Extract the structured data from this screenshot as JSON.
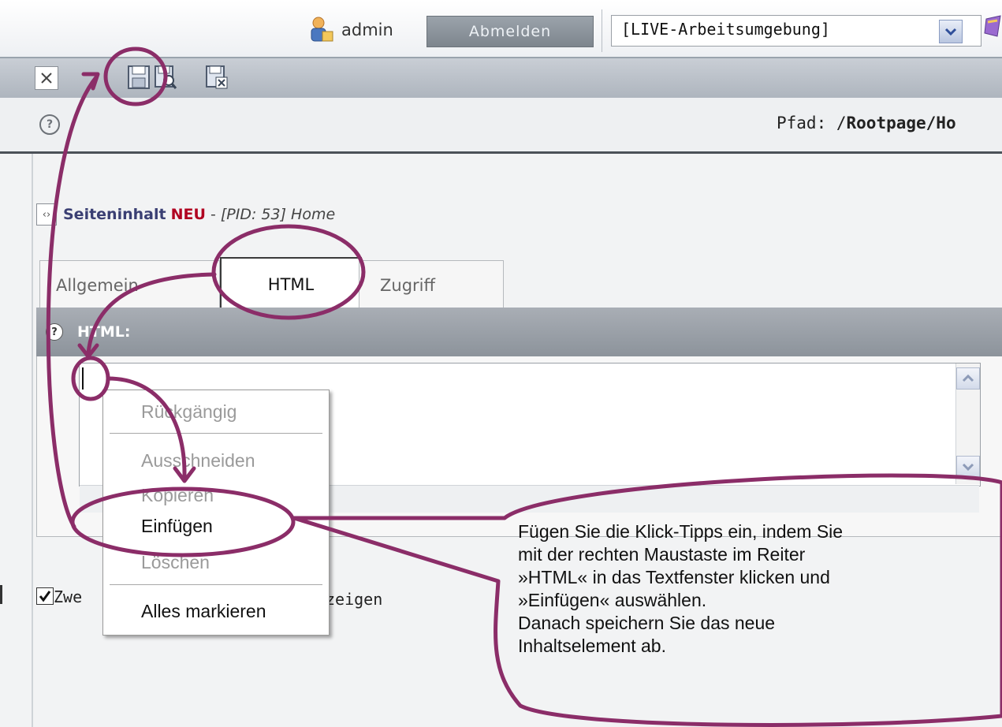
{
  "header": {
    "user_name": "admin",
    "logout_label": "Abmelden",
    "workspace_value": "[LIVE-Arbeitsumgebung]"
  },
  "path": {
    "label": "Pfad: /",
    "value": "Rootpage/Ho"
  },
  "content": {
    "title_type": "Seiteninhalt",
    "title_badge": "NEU",
    "title_dash": " - ",
    "title_ref": "[PID: 53] Home"
  },
  "tabs": [
    {
      "label": "Allgemein"
    },
    {
      "label": "HTML"
    },
    {
      "label": "Zugriff"
    }
  ],
  "section": {
    "label": "HTML:"
  },
  "rte_toggle": {
    "label_start": "Zwe",
    "label_end": "zeigen"
  },
  "context_menu": {
    "items": [
      {
        "label": "Rückgängig",
        "enabled": false
      },
      {
        "label": "Ausschneiden",
        "enabled": false
      },
      {
        "label": "Kopieren",
        "enabled": false
      },
      {
        "label": "Einfügen",
        "enabled": true
      },
      {
        "label": "Löschen",
        "enabled": false
      },
      {
        "label": "Alles markieren",
        "enabled": true
      }
    ]
  },
  "callout": {
    "lines": [
      "Fügen Sie die Klick-Tipps ein, indem Sie",
      "mit der rechten Maustaste im Reiter",
      "»HTML« in das Textfenster klicken und",
      "»Einfügen« auswählen.",
      "Danach speichern Sie das neue",
      "Inhaltselement ab."
    ]
  },
  "colors": {
    "annotation": "#8b2d68",
    "accent_red": "#b00020",
    "title_blue": "#3a3f73"
  }
}
